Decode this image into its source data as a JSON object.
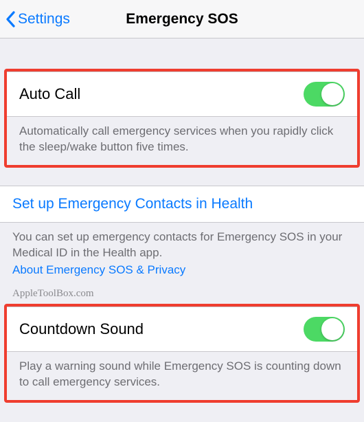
{
  "nav": {
    "back_label": "Settings",
    "title": "Emergency SOS"
  },
  "auto_call": {
    "label": "Auto Call",
    "on": true,
    "footer": "Automatically call emergency services when you rapidly click the sleep/wake button five times."
  },
  "contacts": {
    "link_label": "Set up Emergency Contacts in Health",
    "footer": "You can set up emergency contacts for Emergency SOS in your Medical ID in the Health app.",
    "privacy_link": "About Emergency SOS & Privacy"
  },
  "watermark": "AppleToolBox.com",
  "countdown": {
    "label": "Countdown Sound",
    "on": true,
    "footer": "Play a warning sound while Emergency SOS is counting down to call emergency services."
  },
  "colors": {
    "accent": "#0a7aff",
    "toggle_on": "#4cd964",
    "highlight_border": "#ef3d2f"
  }
}
